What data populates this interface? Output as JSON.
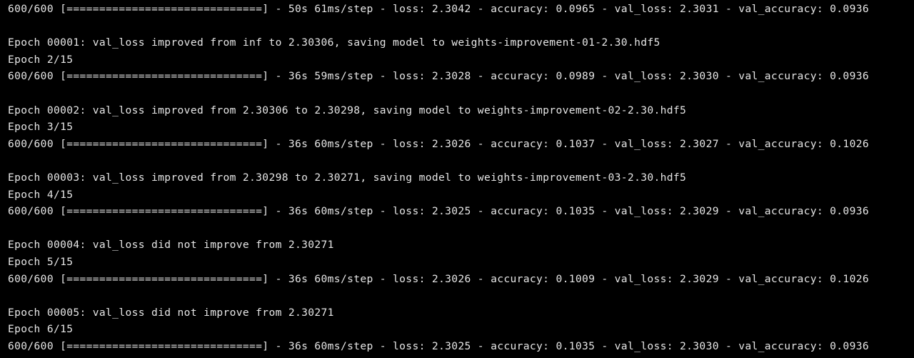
{
  "terminal": {
    "lines": [
      "600/600 [==============================] - 50s 61ms/step - loss: 2.3042 - accuracy: 0.0965 - val_loss: 2.3031 - val_accuracy: 0.0936",
      "",
      "Epoch 00001: val_loss improved from inf to 2.30306, saving model to weights-improvement-01-2.30.hdf5",
      "Epoch 2/15",
      "600/600 [==============================] - 36s 59ms/step - loss: 2.3028 - accuracy: 0.0989 - val_loss: 2.3030 - val_accuracy: 0.0936",
      "",
      "Epoch 00002: val_loss improved from 2.30306 to 2.30298, saving model to weights-improvement-02-2.30.hdf5",
      "Epoch 3/15",
      "600/600 [==============================] - 36s 60ms/step - loss: 2.3026 - accuracy: 0.1037 - val_loss: 2.3027 - val_accuracy: 0.1026",
      "",
      "Epoch 00003: val_loss improved from 2.30298 to 2.30271, saving model to weights-improvement-03-2.30.hdf5",
      "Epoch 4/15",
      "600/600 [==============================] - 36s 60ms/step - loss: 2.3025 - accuracy: 0.1035 - val_loss: 2.3029 - val_accuracy: 0.0936",
      "",
      "Epoch 00004: val_loss did not improve from 2.30271",
      "Epoch 5/15",
      "600/600 [==============================] - 36s 60ms/step - loss: 2.3026 - accuracy: 0.1009 - val_loss: 2.3029 - val_accuracy: 0.1026",
      "",
      "Epoch 00005: val_loss did not improve from 2.30271",
      "Epoch 6/15",
      "600/600 [==============================] - 36s 60ms/step - loss: 2.3025 - accuracy: 0.1035 - val_loss: 2.3030 - val_accuracy: 0.0936"
    ],
    "colors": {
      "background": "#000000",
      "text": "#e6e6e6"
    }
  }
}
